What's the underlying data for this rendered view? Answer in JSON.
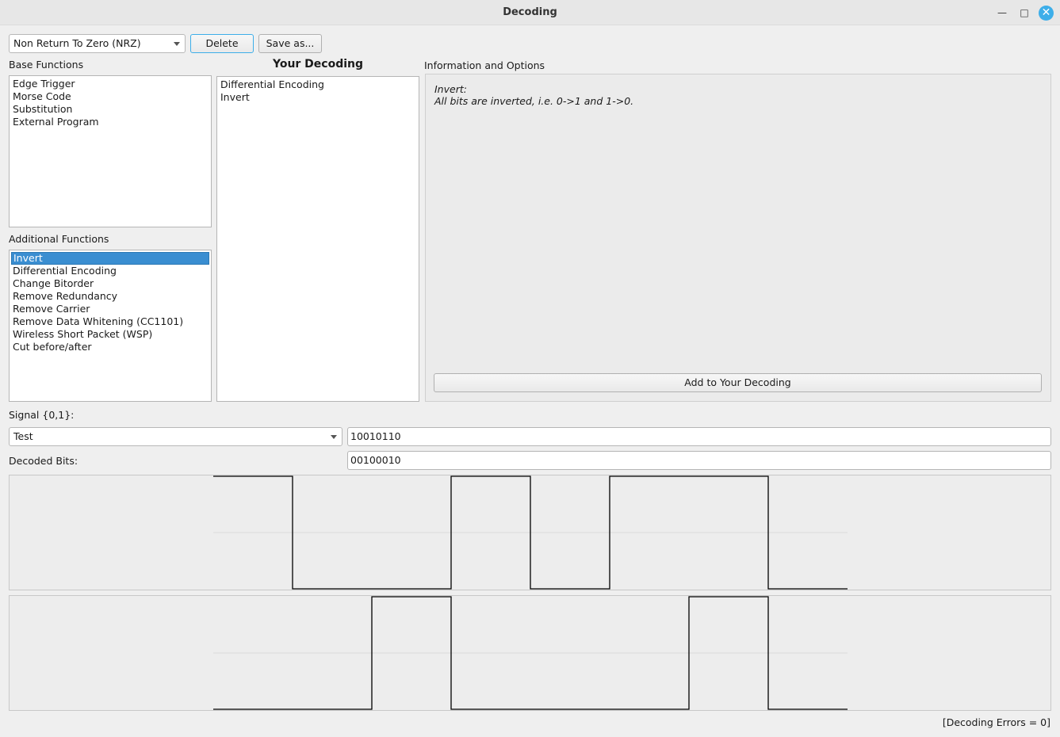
{
  "window": {
    "title": "Decoding"
  },
  "toolbar": {
    "decoding_selected": "Non Return To Zero (NRZ)",
    "delete_label": "Delete",
    "save_label": "Save as..."
  },
  "base_functions": {
    "label": "Base Functions",
    "items": [
      "Edge Trigger",
      "Morse Code",
      "Substitution",
      "External Program"
    ]
  },
  "additional_functions": {
    "label": "Additional Functions",
    "selected": "Invert",
    "items": [
      "Invert",
      "Differential Encoding",
      "Change Bitorder",
      "Remove Redundancy",
      "Remove Carrier",
      "Remove Data Whitening (CC1101)",
      "Wireless Short Packet (WSP)",
      "Cut before/after"
    ]
  },
  "your_decoding": {
    "label": "Your Decoding",
    "items": [
      "Differential Encoding",
      "Invert"
    ]
  },
  "info": {
    "label": "Information and Options",
    "title": "Invert:",
    "description": "All bits are inverted, i.e. 0->1 and 1->0.",
    "add_button": "Add to Your Decoding"
  },
  "signal": {
    "label": "Signal {0,1}:",
    "selected": "Test",
    "bits": "10010110"
  },
  "decoded": {
    "label": "Decoded Bits:",
    "bits": "00100010"
  },
  "status": {
    "errors_text": "[Decoding Errors = 0]"
  },
  "colors": {
    "accent": "#3daee9",
    "selection": "#3a8ed1",
    "waveform": "#000000"
  },
  "icons": [
    "minimize-icon",
    "maximize-icon",
    "close-icon",
    "chevron-down-icon"
  ]
}
